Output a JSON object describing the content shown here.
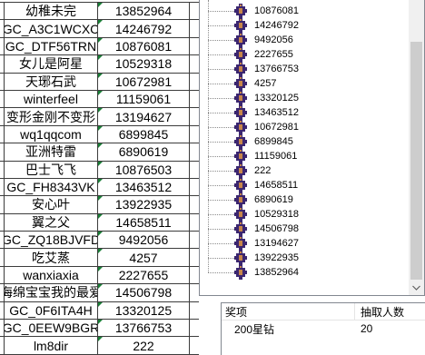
{
  "sheet": {
    "rows": [
      [
        "幼稚未完",
        "13852964"
      ],
      [
        "GC_A3C1WCXC",
        "14246792"
      ],
      [
        "GC_DTF56TRN",
        "10876081"
      ],
      [
        "女儿是阿星",
        "10529318"
      ],
      [
        "天琊石武",
        "10672981"
      ],
      [
        "winterfeel",
        "11159061"
      ],
      [
        "变形金刚不变形",
        "13194627"
      ],
      [
        "wq1qqcom",
        "6899845"
      ],
      [
        "亚洲特雷",
        "6890619"
      ],
      [
        "巴士飞飞",
        "10876503"
      ],
      [
        "GC_FH8343VK",
        "13463512"
      ],
      [
        "安心叶",
        "13922935"
      ],
      [
        "翼之父",
        "14658511"
      ],
      [
        "GC_ZQ18BJVFD",
        "9492056"
      ],
      [
        "吃艾蒸",
        "4257"
      ],
      [
        "wanxiaxia",
        "2227655"
      ],
      [
        "海绵宝宝我的最爱",
        "14506798"
      ],
      [
        "GC_0F6ITA4H",
        "13320125"
      ],
      [
        "GC_0EEW9BGR",
        "13766753"
      ],
      [
        "lm8dir",
        "222"
      ]
    ],
    "number_cell_icon": "error-indicator-icon"
  },
  "tree": {
    "item_icon": "member-icon",
    "scrollbar_down_icon": "chevron-down-icon",
    "items": [
      "10876081",
      "14246792",
      "9492056",
      "2227655",
      "13766753",
      "4257",
      "13320125",
      "13463512",
      "10672981",
      "6899845",
      "11159061",
      "222",
      "14658511",
      "6890619",
      "10529318",
      "14506798",
      "13194627",
      "13922935",
      "13852964"
    ]
  },
  "prize_list": {
    "columns": [
      "奖项",
      "抽取人数"
    ],
    "rows": [
      [
        "200星钻",
        "20"
      ]
    ]
  },
  "colors": {
    "gridline": "#3c3c3c",
    "error_indicator": "#1a7f37",
    "icon_primary": "#3b2670",
    "icon_accent": "#c7864a",
    "scroll_thumb": "#cdcdcd",
    "scroll_track": "#f0f0f0",
    "tree_line": "#8c8c8c"
  }
}
